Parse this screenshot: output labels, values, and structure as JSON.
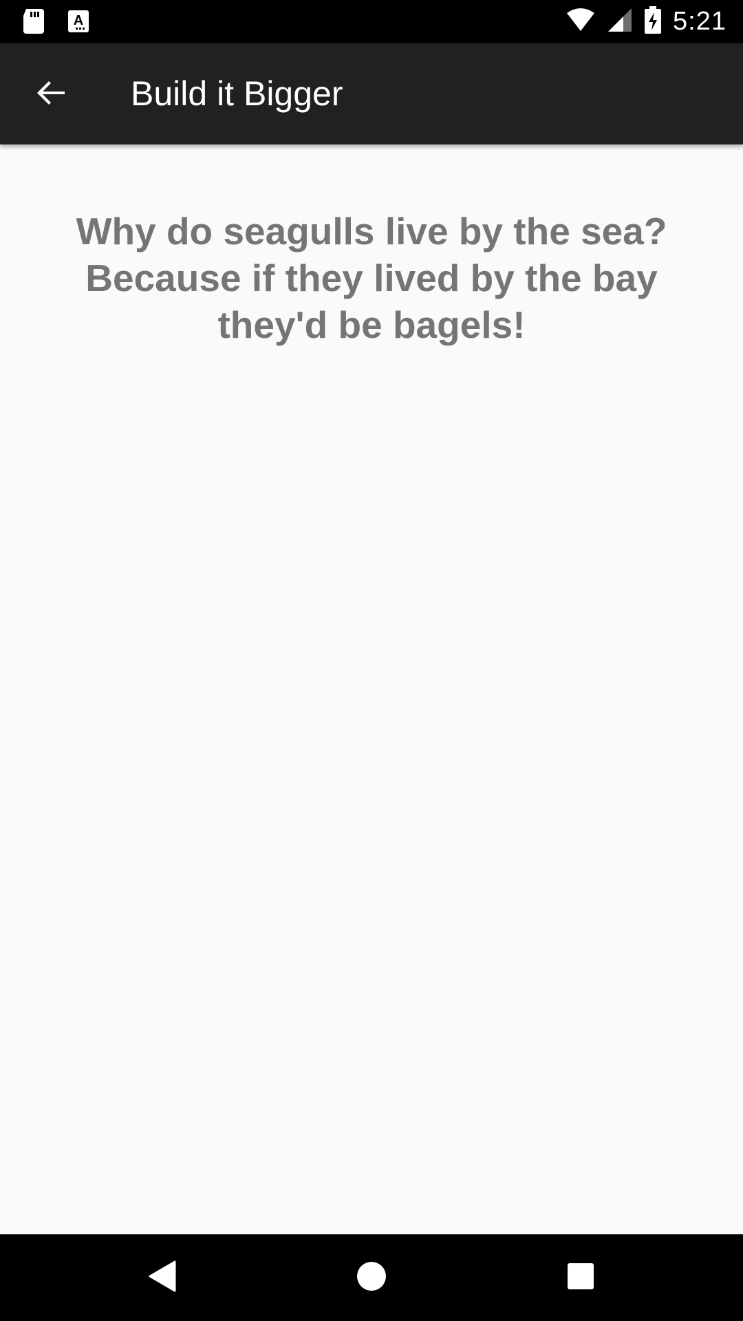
{
  "status_bar": {
    "time": "5:21",
    "icons": [
      "sd-card-icon",
      "accessibility-app-icon",
      "wifi-icon",
      "cellular-signal-icon",
      "battery-charging-icon"
    ]
  },
  "app_bar": {
    "title": "Build it Bigger",
    "back_icon": "arrow-back-icon",
    "background_color": "#212121"
  },
  "content": {
    "joke": "Why do seagulls live by the sea? Because if they lived by the bay they'd be bagels!",
    "text_color": "#757575"
  },
  "nav_bar": {
    "buttons": [
      "back-triangle-icon",
      "home-circle-icon",
      "recents-square-icon"
    ]
  }
}
